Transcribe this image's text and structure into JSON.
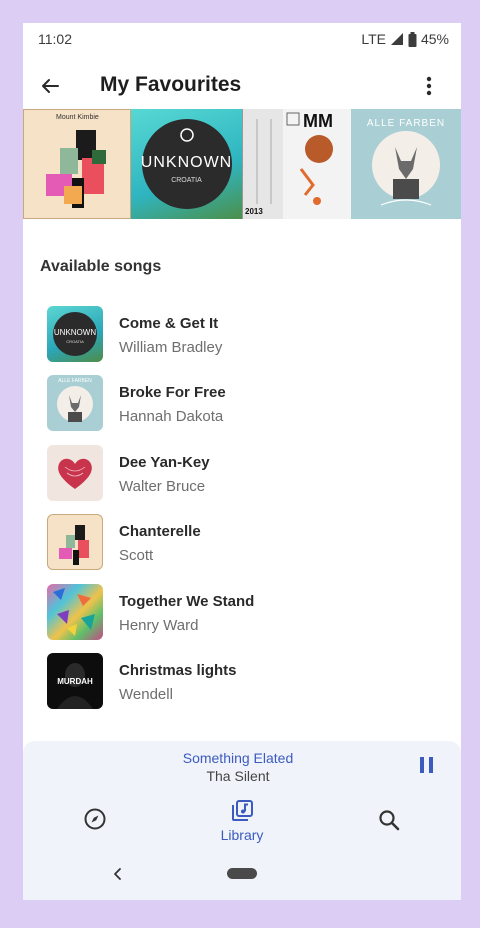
{
  "status_bar": {
    "time": "11:02",
    "network": "LTE",
    "battery": "45%"
  },
  "header": {
    "title": "My Favourites",
    "back_icon": "arrow-left-icon",
    "more_icon": "more-vertical-icon"
  },
  "collage": {
    "art1_text": "Mount Kimbie",
    "art2_text": "UNKNOWN",
    "art2_sub": "CROATIA",
    "art3_text": "MM",
    "art3_year": "2013",
    "art4_text": "ALLE FARBEN"
  },
  "section": {
    "title": "Available songs"
  },
  "songs": [
    {
      "title": "Come & Get It",
      "artist": "William Bradley",
      "thumb_text": "UNKNOWN",
      "thumb_sub": "CROATIA"
    },
    {
      "title": "Broke For Free",
      "artist": "Hannah Dakota",
      "thumb_text": "ALLE FARBEN"
    },
    {
      "title": "Dee Yan-Key",
      "artist": "Walter Bruce"
    },
    {
      "title": "Chanterelle",
      "artist": "Scott"
    },
    {
      "title": "Together We Stand",
      "artist": "Henry Ward"
    },
    {
      "title": "Christmas lights",
      "artist": "Wendell",
      "thumb_text": "MURDAH"
    }
  ],
  "player": {
    "title": "Something Elated",
    "artist": "Tha Silent",
    "state_icon": "pause-icon"
  },
  "bottom_nav": {
    "items": [
      {
        "icon": "compass-icon"
      },
      {
        "icon": "library-icon",
        "label": "Library",
        "active": true
      },
      {
        "icon": "search-icon"
      }
    ]
  },
  "colors": {
    "accent": "#3b5bbf",
    "background": "#dccdf4"
  }
}
